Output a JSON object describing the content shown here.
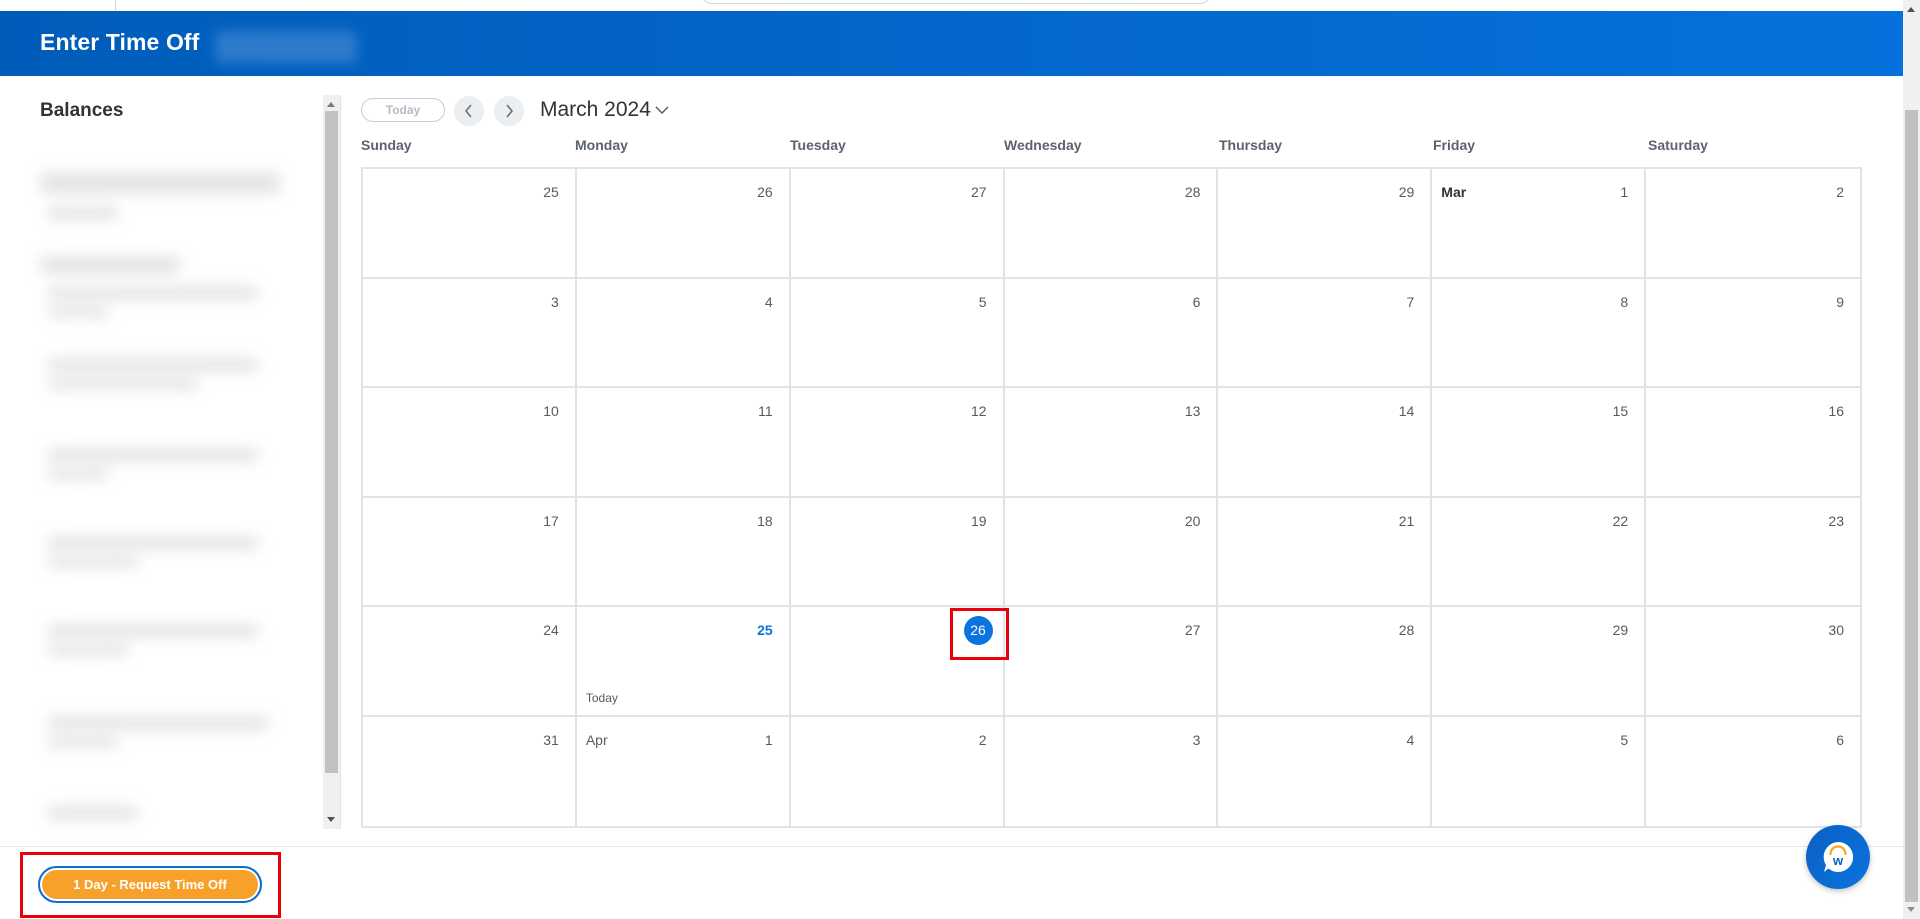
{
  "header": {
    "title": "Enter Time Off"
  },
  "sidebar": {
    "heading": "Balances"
  },
  "toolbar": {
    "today_label": "Today",
    "prev_icon": "chevron-left-icon",
    "next_icon": "chevron-right-icon",
    "month_label": "March 2024",
    "month_dropdown_icon": "chevron-down-icon"
  },
  "calendar": {
    "weekdays": [
      "Sunday",
      "Monday",
      "Tuesday",
      "Wednesday",
      "Thursday",
      "Friday",
      "Saturday"
    ],
    "today_label": "Today",
    "today_date": "March 25, 2024",
    "selected_date": "March 26, 2024",
    "weeks": [
      [
        {
          "d": "25"
        },
        {
          "d": "26"
        },
        {
          "d": "27"
        },
        {
          "d": "28"
        },
        {
          "d": "29"
        },
        {
          "d": "1",
          "month": "Mar"
        },
        {
          "d": "2"
        }
      ],
      [
        {
          "d": "3"
        },
        {
          "d": "4"
        },
        {
          "d": "5"
        },
        {
          "d": "6"
        },
        {
          "d": "7"
        },
        {
          "d": "8"
        },
        {
          "d": "9"
        }
      ],
      [
        {
          "d": "10"
        },
        {
          "d": "11"
        },
        {
          "d": "12"
        },
        {
          "d": "13"
        },
        {
          "d": "14"
        },
        {
          "d": "15"
        },
        {
          "d": "16"
        }
      ],
      [
        {
          "d": "17"
        },
        {
          "d": "18"
        },
        {
          "d": "19"
        },
        {
          "d": "20"
        },
        {
          "d": "21"
        },
        {
          "d": "22"
        },
        {
          "d": "23"
        }
      ],
      [
        {
          "d": "24"
        },
        {
          "d": "25",
          "today": true
        },
        {
          "d": "26",
          "selected": true
        },
        {
          "d": "27"
        },
        {
          "d": "28"
        },
        {
          "d": "29"
        },
        {
          "d": "30"
        }
      ],
      [
        {
          "d": "31"
        },
        {
          "d": "1",
          "month": "Apr"
        },
        {
          "d": "2"
        },
        {
          "d": "3"
        },
        {
          "d": "4"
        },
        {
          "d": "5"
        },
        {
          "d": "6"
        }
      ]
    ]
  },
  "footer": {
    "request_button_label": "1 Day - Request Time Off"
  },
  "chat": {
    "icon": "workday-assistant-icon",
    "letter": "w"
  },
  "colors": {
    "header_blue": "#005cb9",
    "accent_blue": "#0b74de",
    "request_orange": "#f7a12a",
    "highlight_red": "#e8000b"
  }
}
